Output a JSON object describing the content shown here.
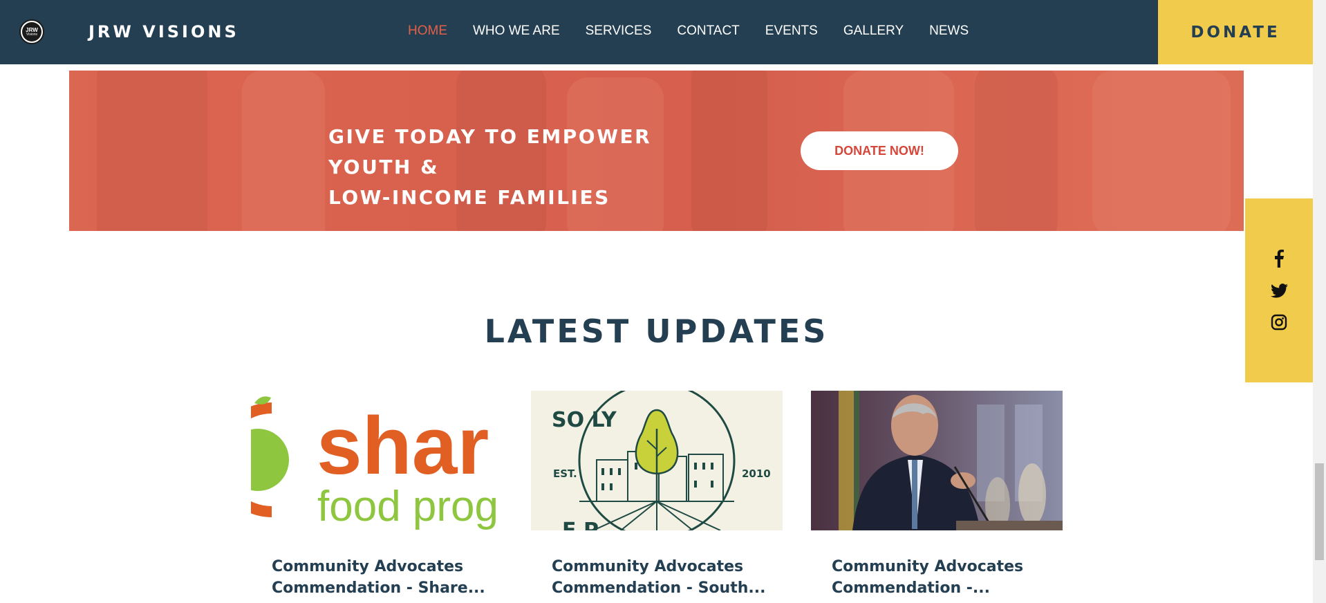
{
  "header": {
    "logo_text_top": "JRW",
    "logo_text_bottom": "Visions",
    "brand": "JRW VISIONS",
    "nav": [
      "HOME",
      "WHO WE ARE",
      "SERVICES",
      "CONTACT",
      "EVENTS",
      "GALLERY",
      "NEWS"
    ],
    "active_nav": "HOME",
    "donate_label": "DONATE"
  },
  "banner": {
    "title_line1": "GIVE TODAY TO EMPOWER YOUTH &",
    "title_line2": "LOW-INCOME FAMILIES",
    "button_label": "DONATE NOW!"
  },
  "social": {
    "icons": [
      "facebook-icon",
      "twitter-icon",
      "instagram-icon"
    ]
  },
  "latest": {
    "title": "LATEST UPDATES",
    "cards": [
      {
        "image_text_1": "shar",
        "image_text_2": "food prog",
        "title_line1": "Community Advocates",
        "title_line2": "Commendation - Share..."
      },
      {
        "image_text_top": "SO         LY",
        "image_est": "EST.",
        "image_year": "2010",
        "image_text_bottom": "F               P",
        "title_line1": "Community Advocates",
        "title_line2": "Commendation - South..."
      },
      {
        "title_line1": "Community Advocates",
        "title_line2": "Commendation -..."
      }
    ]
  },
  "colors": {
    "header_bg": "#243f52",
    "accent_yellow": "#f1cb4b",
    "nav_active": "#e2604a",
    "banner_red": "#d6604c",
    "heading_navy": "#243f52"
  }
}
